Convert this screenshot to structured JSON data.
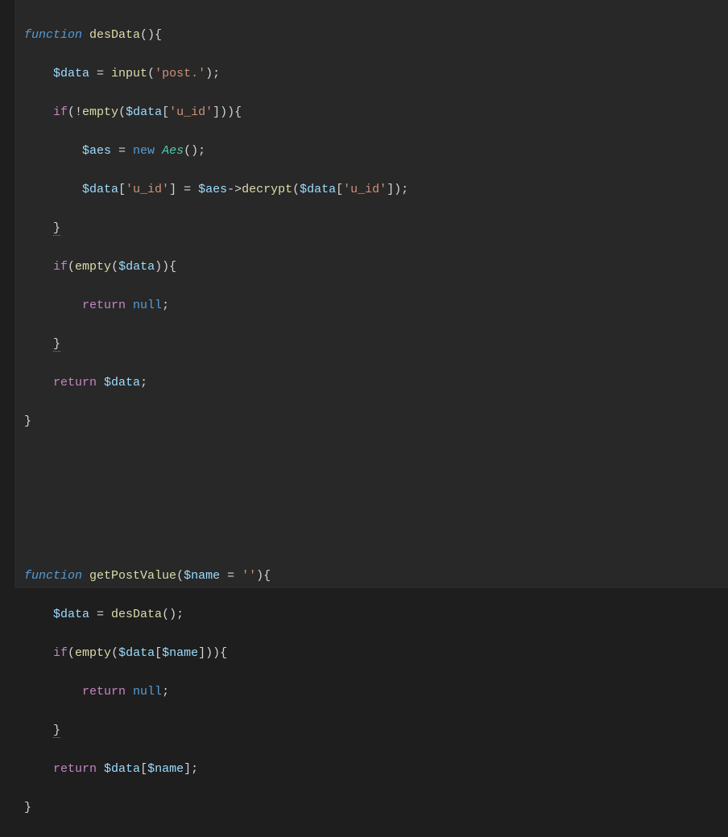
{
  "code": {
    "l1": {
      "kw_function": "function",
      "fn": "desData",
      "paren_brace": "(){"
    },
    "l2": {
      "var_data": "$data",
      "eq": " = ",
      "fn_input": "input",
      "open": "(",
      "str_post": "'post.'",
      "close": ");"
    },
    "l3": {
      "kw_if": "if",
      "open": "(!",
      "fn_empty": "empty",
      "p2": "(",
      "var_data": "$data",
      "brk": "[",
      "str_uid": "'u_id'",
      "brk2": "])){",
      "close_paren": ""
    },
    "l4": {
      "var_aes": "$aes",
      "eq": " = ",
      "kw_new": "new",
      "sp": " ",
      "cls": "Aes",
      "end": "();"
    },
    "l5": {
      "var_data": "$data",
      "brk": "[",
      "str_uid": "'u_id'",
      "brk2": "] = ",
      "var_aes": "$aes",
      "arrow": "->",
      "fn_decrypt": "decrypt",
      "p": "(",
      "var_data2": "$data",
      "brk3": "[",
      "str_uid2": "'u_id'",
      "end": "]);"
    },
    "l6": {
      "brace": "}"
    },
    "l7": {
      "kw_if": "if",
      "open": "(",
      "fn_empty": "empty",
      "p": "(",
      "var_data": "$data",
      "end": ")){"
    },
    "l8": {
      "kw_return": "return",
      "sp": " ",
      "null": "null",
      "semi": ";"
    },
    "l9": {
      "brace": "}"
    },
    "l10": {
      "kw_return": "return",
      "sp": " ",
      "var_data": "$data",
      "semi": ";"
    },
    "l11": {
      "brace": "}"
    },
    "l15": {
      "kw_function": "function",
      "fn": "getPostValue",
      "open": "(",
      "var_name": "$name",
      "eq": " = ",
      "str_empty": "''",
      "end": "){"
    },
    "l16": {
      "var_data": "$data",
      "eq": " = ",
      "fn_desData": "desData",
      "end": "();"
    },
    "l17": {
      "kw_if": "if",
      "open": "(",
      "fn_empty": "empty",
      "p": "(",
      "var_data": "$data",
      "brk": "[",
      "var_name": "$name",
      "end": "])){"
    },
    "l18": {
      "kw_return": "return",
      "sp": " ",
      "null": "null",
      "semi": ";"
    },
    "l19": {
      "brace": "}"
    },
    "l20": {
      "kw_return": "return",
      "sp": " ",
      "var_data": "$data",
      "brk": "[",
      "var_name": "$name",
      "end": "];"
    },
    "l21": {
      "brace": "}"
    }
  }
}
